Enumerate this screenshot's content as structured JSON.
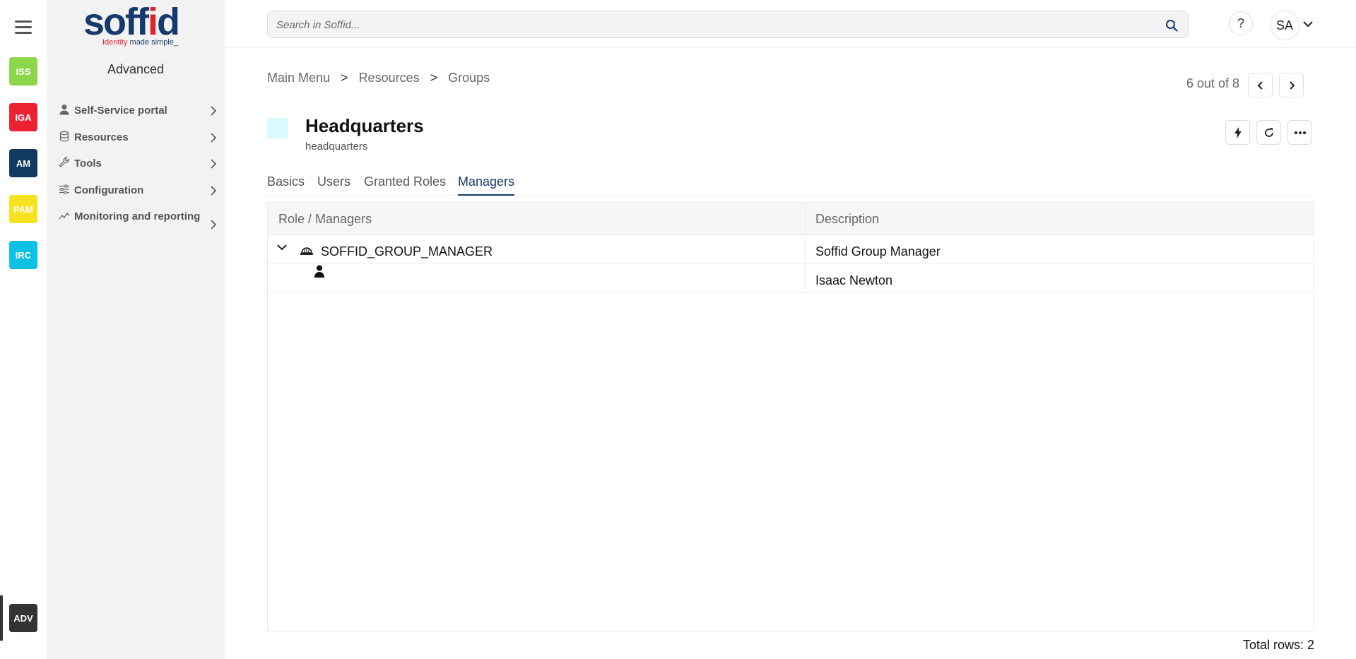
{
  "rail": {
    "apps": [
      {
        "label": "ISS",
        "color": "#8dd54a"
      },
      {
        "label": "IGA",
        "color": "#ec2232"
      },
      {
        "label": "AM",
        "color": "#113a61"
      },
      {
        "label": "PAM",
        "color": "#f6e21f"
      },
      {
        "label": "IRC",
        "color": "#0bc1e4"
      }
    ],
    "active_app": {
      "label": "ADV",
      "color": "#333333"
    }
  },
  "sidebar": {
    "logo_word_1": "soff",
    "logo_word_2": "i",
    "logo_word_3": "d",
    "logo_tag_1": "Identity",
    "logo_tag_2": " made simple_",
    "title": "Advanced",
    "items": [
      {
        "label": "Self-Service portal",
        "icon": "person-icon"
      },
      {
        "label": "Resources",
        "icon": "database-icon"
      },
      {
        "label": "Tools",
        "icon": "wrench-icon"
      },
      {
        "label": "Configuration",
        "icon": "sliders-icon"
      },
      {
        "label": "Monitoring and reporting",
        "icon": "trend-icon"
      }
    ]
  },
  "header": {
    "search_placeholder": "Search in Soffid...",
    "help_label": "?",
    "user_initials": "SA"
  },
  "breadcrumb": {
    "items": [
      "Main Menu",
      "Resources",
      "Groups"
    ],
    "separator": ">"
  },
  "pager": {
    "text": "6 out of 8"
  },
  "group": {
    "name": "Headquarters",
    "code": "headquarters",
    "swatch_color": "#d9f9fc"
  },
  "tabs": [
    {
      "label": "Basics",
      "active": false
    },
    {
      "label": "Users",
      "active": false
    },
    {
      "label": "Granted Roles",
      "active": false
    },
    {
      "label": "Managers",
      "active": true
    }
  ],
  "table": {
    "columns": [
      "Role / Managers",
      "Description"
    ],
    "rows": [
      {
        "role": "SOFFID_GROUP_MANAGER",
        "description": "Soffid Group Manager",
        "icon": "role-helmet-icon",
        "expanded": true
      },
      {
        "role": "",
        "description": "Isaac Newton",
        "icon": "user-icon"
      }
    ],
    "total_rows": "Total rows: 2"
  }
}
